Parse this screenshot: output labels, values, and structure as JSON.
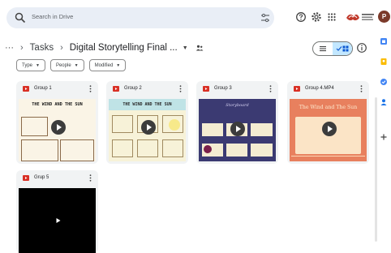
{
  "search": {
    "placeholder": "Search in Drive"
  },
  "avatar": {
    "initial": "P"
  },
  "breadcrumb": {
    "more": "···",
    "parent": "Tasks",
    "current": "Digital Storytelling Final ..."
  },
  "filters": [
    {
      "label": "Type"
    },
    {
      "label": "People"
    },
    {
      "label": "Modified"
    }
  ],
  "files": [
    {
      "name": "Group 1",
      "thumb_text": "THE WIND AND THE SUN"
    },
    {
      "name": "Group 2",
      "thumb_text": "THE WIND AND THE SUN"
    },
    {
      "name": "Group 3",
      "thumb_text": "Storyboard"
    },
    {
      "name": "Group 4.MP4",
      "thumb_text": "The Wind and The Sun"
    },
    {
      "name": "Grup 5"
    }
  ],
  "colors": {
    "video_icon": "#d93025",
    "accent_toggle": "#c2e7ff",
    "card_bg": "#f1f3f4",
    "avatar": "#7b3a2a"
  },
  "icons": {
    "search": "search-icon",
    "tune": "tune-icon",
    "help": "help-icon",
    "settings": "settings-icon",
    "apps": "apps-grid-icon",
    "share": "shared-folder-icon",
    "list": "list-view-icon",
    "grid": "grid-view-icon",
    "info": "info-icon",
    "more": "more-vert-icon",
    "play": "play-icon"
  }
}
